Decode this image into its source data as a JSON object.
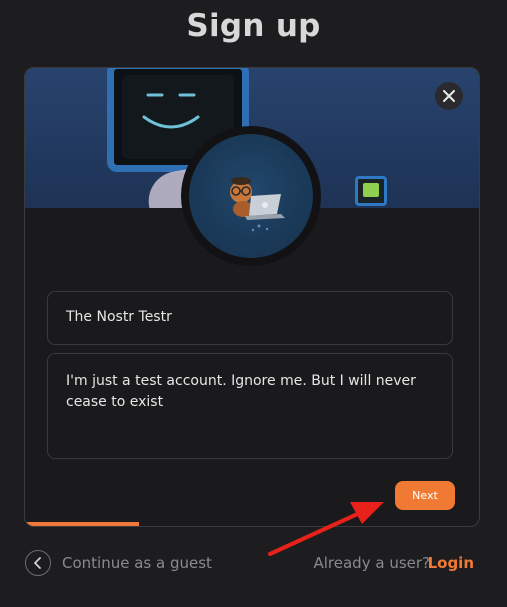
{
  "page": {
    "title": "Sign up"
  },
  "card": {
    "name_value": "The Nostr Testr",
    "about_value": "I'm just a test account. Ignore me. But I will never cease to exist",
    "next_label": "Next",
    "progress": 0.25
  },
  "footer": {
    "guest_label": "Continue as a guest",
    "already_label": "Already a user?",
    "login_label": "Login"
  },
  "icons": {
    "close": "close-icon",
    "back": "chevron-left-icon"
  },
  "colors": {
    "accent": "#f07a33",
    "background": "#1d1d1f",
    "annotation_arrow": "#e8211a"
  }
}
